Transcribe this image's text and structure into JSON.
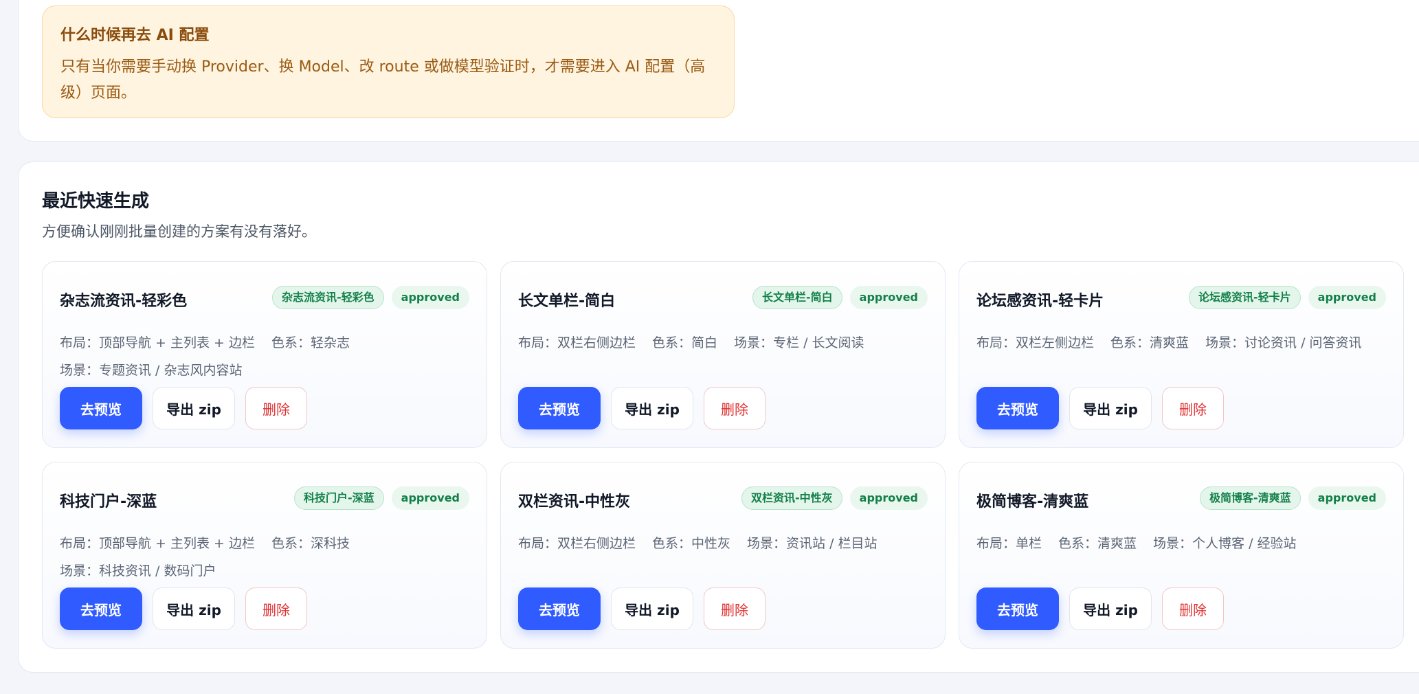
{
  "notice": {
    "title": "什么时候再去 AI 配置",
    "body": "只有当你需要手动换 Provider、换 Model、改 route 或做模型验证时，才需要进入 AI 配置（高级）页面。"
  },
  "recent": {
    "title": "最近快速生成",
    "subtitle": "方便确认刚刚批量创建的方案有没有落好。",
    "labels": {
      "preview": "去预览",
      "export": "导出 zip",
      "delete": "删除"
    },
    "cards": [
      {
        "name": "杂志流资讯-轻彩色",
        "preset": "杂志流资讯-轻彩色",
        "status": "approved",
        "layout": "布局：顶部导航 + 主列表 + 边栏",
        "color": "色系：轻杂志",
        "scene": "场景：专题资讯 / 杂志风内容站"
      },
      {
        "name": "长文单栏-简白",
        "preset": "长文单栏-简白",
        "status": "approved",
        "layout": "布局：双栏右侧边栏",
        "color": "色系：简白",
        "scene": "场景：专栏 / 长文阅读"
      },
      {
        "name": "论坛感资讯-轻卡片",
        "preset": "论坛感资讯-轻卡片",
        "status": "approved",
        "layout": "布局：双栏左侧边栏",
        "color": "色系：清爽蓝",
        "scene": "场景：讨论资讯 / 问答资讯"
      },
      {
        "name": "科技门户-深蓝",
        "preset": "科技门户-深蓝",
        "status": "approved",
        "layout": "布局：顶部导航 + 主列表 + 边栏",
        "color": "色系：深科技",
        "scene": "场景：科技资讯 / 数码门户"
      },
      {
        "name": "双栏资讯-中性灰",
        "preset": "双栏资讯-中性灰",
        "status": "approved",
        "layout": "布局：双栏右侧边栏",
        "color": "色系：中性灰",
        "scene": "场景：资讯站 / 栏目站"
      },
      {
        "name": "极简博客-清爽蓝",
        "preset": "极简博客-清爽蓝",
        "status": "approved",
        "layout": "布局：单栏",
        "color": "色系：清爽蓝",
        "scene": "场景：个人博客 / 经验站"
      }
    ]
  },
  "colors": {
    "primary": "#2f5bff",
    "approved": "#138049",
    "danger": "#e03131",
    "notice_bg": "#fff4e0"
  }
}
